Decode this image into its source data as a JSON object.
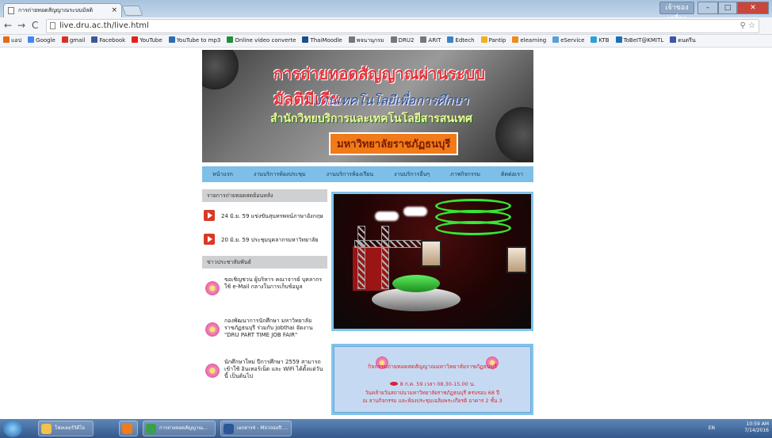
{
  "browser": {
    "tab_title": "การถ่ายทอดสัญญาณระบบมัลติ",
    "tab_close": "×",
    "url": "live.dru.ac.th/live.html",
    "back": "←",
    "forward": "→",
    "reload": "C"
  },
  "bookmarks": [
    {
      "label": "แอป",
      "color": "#e36a1a"
    },
    {
      "label": "Google",
      "color": "#4285f4"
    },
    {
      "label": "gmail",
      "color": "#d93025"
    },
    {
      "label": "Facebook",
      "color": "#3b5998"
    },
    {
      "label": "YouTube",
      "color": "#e62117"
    },
    {
      "label": "YouTube to mp3",
      "color": "#2d6bb3"
    },
    {
      "label": "Online video converte",
      "color": "#1e8f3a"
    },
    {
      "label": "ThaiMoodle",
      "color": "#1a4f8a"
    },
    {
      "label": "พจนานุกรม",
      "color": "#777777"
    },
    {
      "label": "DRU2",
      "color": "#777777"
    },
    {
      "label": "ARIT",
      "color": "#777777"
    },
    {
      "label": "Edtech",
      "color": "#3a83c7"
    },
    {
      "label": "Pantip",
      "color": "#f2b01e"
    },
    {
      "label": "elearning",
      "color": "#f08a1a"
    },
    {
      "label": "eService",
      "color": "#5aa0d6"
    },
    {
      "label": "KTB",
      "color": "#2aa2d8"
    },
    {
      "label": "ToBeIT@KMITL",
      "color": "#1f6fb2"
    },
    {
      "label": "ดนตรีน",
      "color": "#3d55a8"
    }
  ],
  "banner": {
    "title": "การถ่ายทอดสัญญาณผ่านระบบมัลติมีเดีย",
    "subtitle": "งานเทคโนโลยีเพื่อการศึกษา",
    "office": "สำนักวิทยบริการและเทคโนโลยีสารสนเทศ",
    "university": "มหาวิทยาลัยราชภัฏธนบุรี"
  },
  "menu": [
    "หน้าแรก",
    "งานบริการห้องประชุม",
    "งานบริการห้องเรียน",
    "งานบริการอื่นๆ",
    "ภาพกิจกรรม",
    "ติดต่อเรา"
  ],
  "sidebar": {
    "recordings_heading": "รายการถ่ายทอดสดย้อนหลัง",
    "recordings": [
      "24 มิ.ย. 59 แข่งขันสุนทรพจน์ภาษาอังกฤษ",
      "20 มิ.ย. 59 ประชุมบุคลากรมหาวิทยาลัย"
    ],
    "news_heading": "ข่าวประชาสัมพันธ์",
    "news": [
      "ขอเชิญชวน ผู้บริหาร คณาจารย์ บุคลากร ใช้ e-Mail กลางในการเก็บข้อมูล",
      "กองพัฒนาการนักศึกษา มหาวิทยาลัยราชภัฏธนบุรี ร่วมกับ jobthai จัดงาน \"DRU PART TIME JOB FAIR\"",
      "นักศึกษาใหม่ ปีการศึกษา 2559 สามารถเข้าใช้ อินเทอร์เน็ต และ WiFi ได้ตั้งแต่วันนี้ เป็นต้นไป"
    ]
  },
  "info": {
    "title": "กิจกรรมถ่ายทอดสดสัญญาณมหาวิทยาลัยราชภัฏธนบุรี",
    "line1": "8 ก.ค. 59 เวลา 08.30-15.00 น.",
    "line2": "วันคล้ายวันสถาปนามหาวิทยาลัยราชภัฏธนบุรี ครบรอบ 68 ปี",
    "line3": "ณ ลานกิจกรรม และห้องประชุมเฉลิมพระเกียรติ อาคาร 2 ชั้น 3"
  },
  "taskbar": {
    "apps": [
      {
        "label": "โฟลเดอร์วิดีโอ",
        "color": "#f2c24a"
      },
      {
        "label": "",
        "color": "#f07b18"
      },
      {
        "label": "การถ่ายทอดสัญญาณ...",
        "color": "#3aa04a"
      },
      {
        "label": "เอกสาร4 - Microsoft ...",
        "color": "#2b5797"
      }
    ],
    "lang": "EN",
    "time": "10:59 AM",
    "date": "7/14/2016"
  },
  "window": {
    "user": "เจ้าของเครื่อง"
  }
}
